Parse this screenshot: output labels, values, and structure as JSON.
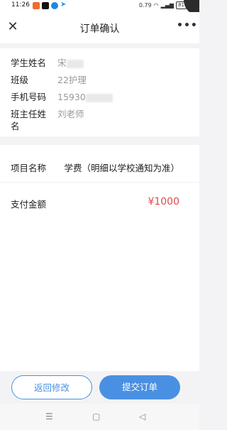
{
  "status_bar": {
    "time": "11:26",
    "net_speed": "0.79\nKB/s",
    "battery": "81"
  },
  "navbar": {
    "close_icon": "close-icon",
    "title": "订单确认",
    "more_icon": "more-dots-icon"
  },
  "student": {
    "rows": [
      {
        "label": "学生姓名",
        "value": "宋"
      },
      {
        "label": "班级",
        "value": "22护理"
      },
      {
        "label": "手机号码",
        "value": "15930"
      },
      {
        "label": "班主任姓名",
        "value": "刘老师"
      }
    ]
  },
  "order": {
    "item_label": "项目名称",
    "item_value": "学费（明细以学校通知为准）",
    "amount_label": "支付金额",
    "amount_value": "¥1000"
  },
  "actions": {
    "back_label": "返回修改",
    "submit_label": "提交订单"
  },
  "colors": {
    "primary": "#4a90e2",
    "price": "#e5484d",
    "background": "#f3f3f5"
  }
}
